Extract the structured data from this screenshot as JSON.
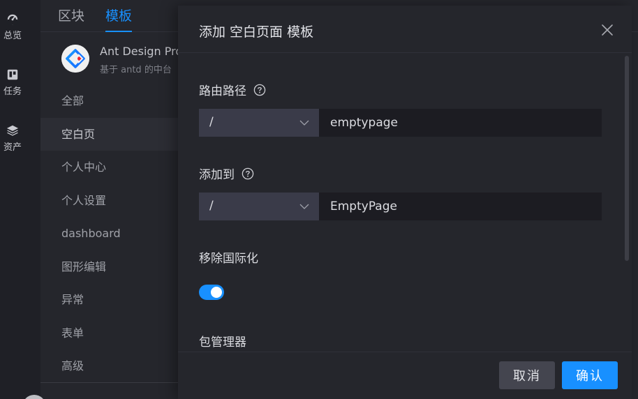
{
  "rail": {
    "items": [
      {
        "label": "总览",
        "icon": "dashboard-icon"
      },
      {
        "label": "任务",
        "icon": "trello-icon"
      },
      {
        "label": "资产",
        "icon": "layers-icon"
      }
    ]
  },
  "tabs": [
    {
      "label": "区块",
      "active": false
    },
    {
      "label": "模板",
      "active": true
    }
  ],
  "project": {
    "name": "Ant Design Pro",
    "description": "基于 antd 的中台"
  },
  "categories": [
    {
      "label": "全部",
      "active": false
    },
    {
      "label": "空白页",
      "active": true
    },
    {
      "label": "个人中心",
      "active": false
    },
    {
      "label": "个人设置",
      "active": false
    },
    {
      "label": "dashboard",
      "active": false
    },
    {
      "label": "图形编辑",
      "active": false
    },
    {
      "label": "异常",
      "active": false
    },
    {
      "label": "表单",
      "active": false
    },
    {
      "label": "高级",
      "active": false
    }
  ],
  "modal": {
    "title": "添加 空白页面 模板",
    "fields": {
      "route": {
        "label": "路由路径",
        "select_value": "/",
        "input_value": "emptypage"
      },
      "add_to": {
        "label": "添加到",
        "select_value": "/",
        "input_value": "EmptyPage"
      },
      "remove_i18n": {
        "label": "移除国际化",
        "checked": true
      },
      "package_manager": {
        "label": "包管理器"
      }
    },
    "footer": {
      "cancel_label": "取消",
      "ok_label": "确认"
    }
  },
  "colors": {
    "accent": "#1890ff",
    "background": "#25262c",
    "rail": "#1f2026"
  }
}
